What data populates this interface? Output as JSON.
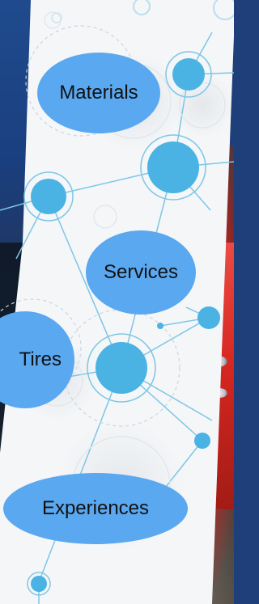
{
  "bubbles": {
    "materials": "Materials",
    "services": "Services",
    "tires": "Tires",
    "experiences": "Experiences"
  },
  "colors": {
    "bubble_fill": "#5aa8f0",
    "node_fill": "#4ab3e4",
    "line": "#7ec6e6",
    "panel": "#f4f6f8"
  }
}
